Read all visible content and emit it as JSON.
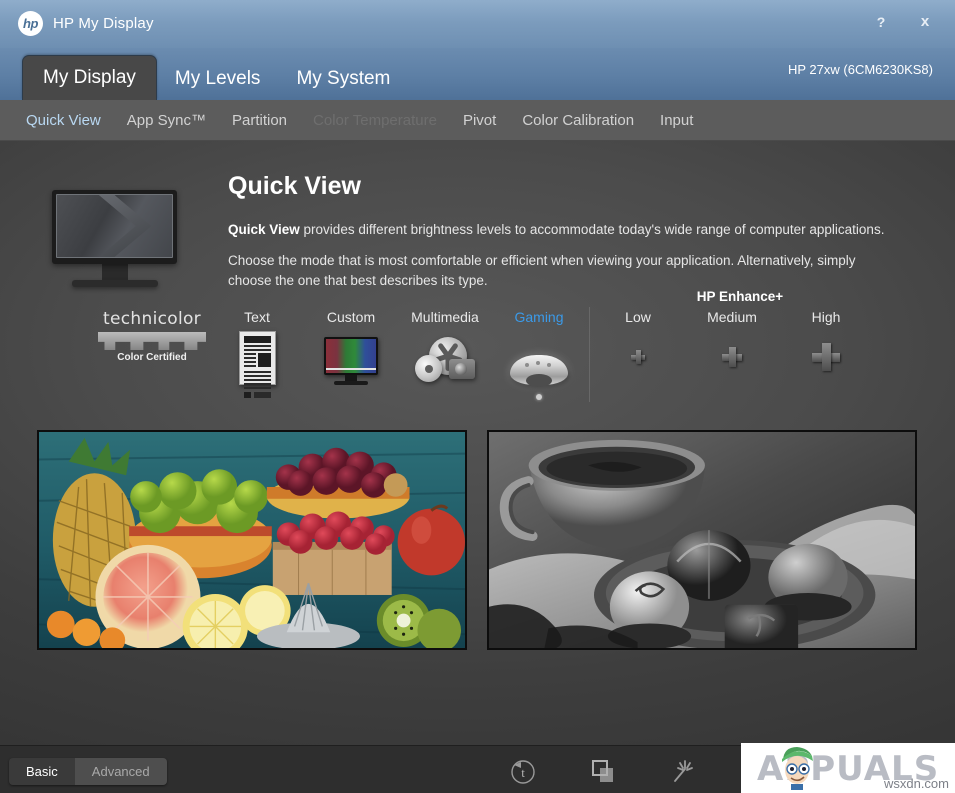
{
  "window": {
    "title": "HP My Display",
    "logo_text": "hp",
    "logo_icon": "hp-logo-icon",
    "help_button": "?",
    "close_button": "x"
  },
  "tabs": [
    {
      "label": "My Display",
      "active": true
    },
    {
      "label": "My Levels",
      "active": false
    },
    {
      "label": "My System",
      "active": false
    }
  ],
  "monitor_model": "HP 27xw (6CM6230KS8)",
  "subnav": [
    {
      "label": "Quick View",
      "state": "active"
    },
    {
      "label": "App Sync™",
      "state": "normal"
    },
    {
      "label": "Partition",
      "state": "normal"
    },
    {
      "label": "Color Temperature",
      "state": "disabled"
    },
    {
      "label": "Pivot",
      "state": "normal"
    },
    {
      "label": "Color Calibration",
      "state": "normal"
    },
    {
      "label": "Input",
      "state": "normal"
    }
  ],
  "content": {
    "heading": "Quick View",
    "paragraph1_bold": "Quick View",
    "paragraph1_rest": " provides different brightness levels to accommodate today's wide range of computer applications.",
    "paragraph2": "Choose the mode that is most comfortable or efficient when viewing your application. Alternatively, simply choose the one that best describes its type.",
    "monitor_illustration": "monitor-illustration-icon"
  },
  "technicolor": {
    "name": "technicolor",
    "subtitle": "Color Certified"
  },
  "modes": [
    {
      "label": "Text",
      "icon": "text-document-icon",
      "selected": false
    },
    {
      "label": "Custom",
      "icon": "custom-monitor-icon",
      "selected": false
    },
    {
      "label": "Multimedia",
      "icon": "multimedia-reel-icon",
      "selected": false
    },
    {
      "label": "Gaming",
      "icon": "gamepad-icon",
      "selected": true
    }
  ],
  "enhance": {
    "title": "HP Enhance+",
    "levels": [
      {
        "label": "Low",
        "icon": "plus-small-icon",
        "size": "s"
      },
      {
        "label": "Medium",
        "icon": "plus-medium-icon",
        "size": "m"
      },
      {
        "label": "High",
        "icon": "plus-large-icon",
        "size": "l"
      }
    ]
  },
  "previews": [
    {
      "name": "color-fruit-photo",
      "description": "Color photograph of assorted fruit: pineapple, limes, grapes, raspberries, apple, grapefruit, lemons, kiwi and a juicer on a blue wooden table"
    },
    {
      "name": "grayscale-coffee-photo",
      "description": "Black and white photograph of a coffee cup and a plate of chocolate truffles on fabric"
    }
  ],
  "bottom": {
    "segmented": [
      {
        "label": "Basic",
        "selected": true
      },
      {
        "label": "Advanced",
        "selected": false
      }
    ],
    "tools": [
      {
        "name": "reset-icon",
        "title": "Reset"
      },
      {
        "name": "windows-icon",
        "title": "Windows"
      },
      {
        "name": "magic-wand-icon",
        "title": "Auto adjust"
      }
    ]
  },
  "watermark": {
    "brand": "APPUALS",
    "url": "wsxdn.com"
  },
  "colors": {
    "titlebar_blue": "#7c9cbd",
    "tabstrip_blue": "#5d7fa5",
    "accent_blue": "#3b9ae8",
    "subnav_active": "#b9d8f2",
    "panel_gray": "#4b4b4b",
    "bottom_bar": "#2e2e2e"
  }
}
